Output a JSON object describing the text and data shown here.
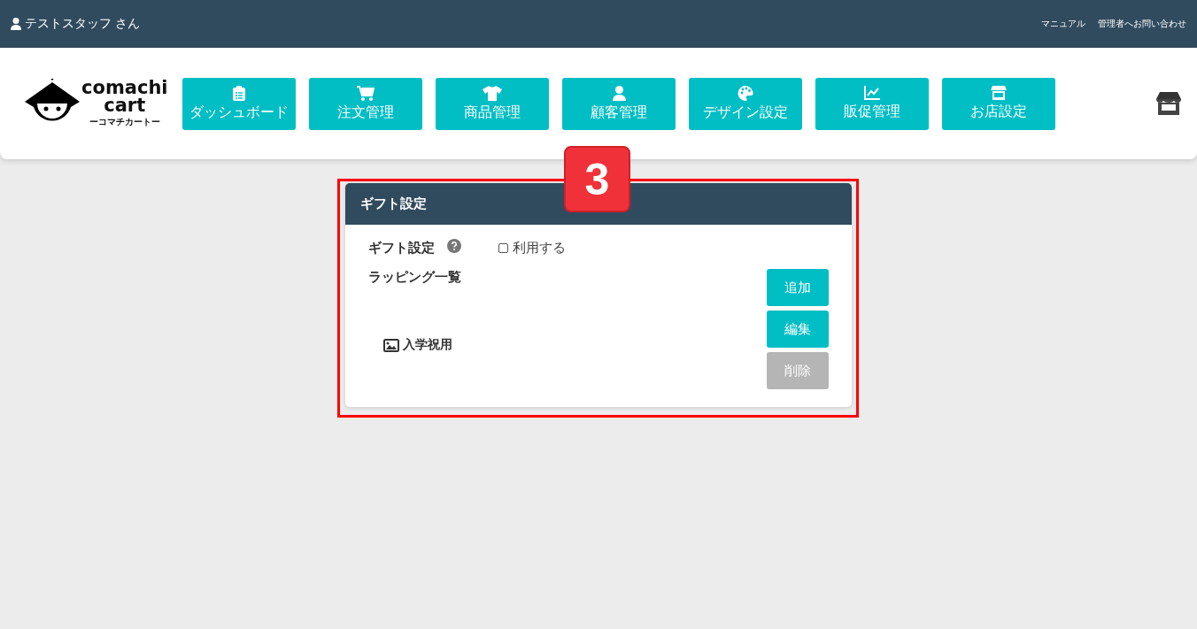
{
  "topbar": {
    "user": "テストスタッフ さん",
    "links": [
      "マニュアル",
      "管理者へお問い合わせ"
    ]
  },
  "logo": {
    "name_line1": "comachi",
    "name_line2": "cart",
    "kana": "ーコマチカートー"
  },
  "nav": [
    {
      "label": "ダッシュボード",
      "kind": "clipboard"
    },
    {
      "label": "注文管理",
      "kind": "cart"
    },
    {
      "label": "商品管理",
      "kind": "shirt"
    },
    {
      "label": "顧客管理",
      "kind": "user"
    },
    {
      "label": "デザイン設定",
      "kind": "palette"
    },
    {
      "label": "販促管理",
      "kind": "chart"
    },
    {
      "label": "お店設定",
      "kind": "store"
    }
  ],
  "callout": {
    "number": "3"
  },
  "gift_card": {
    "title": "ギフト設定",
    "setting_label": "ギフト設定",
    "use_checkbox": {
      "label": "利用する",
      "checked": false
    },
    "wrapping_title": "ラッピング一覧",
    "wrappings": [
      {
        "name": "入学祝用"
      }
    ],
    "buttons": [
      {
        "label": "追加",
        "disabled": false
      },
      {
        "label": "編集",
        "disabled": false
      },
      {
        "label": "削除",
        "disabled": true
      }
    ]
  }
}
